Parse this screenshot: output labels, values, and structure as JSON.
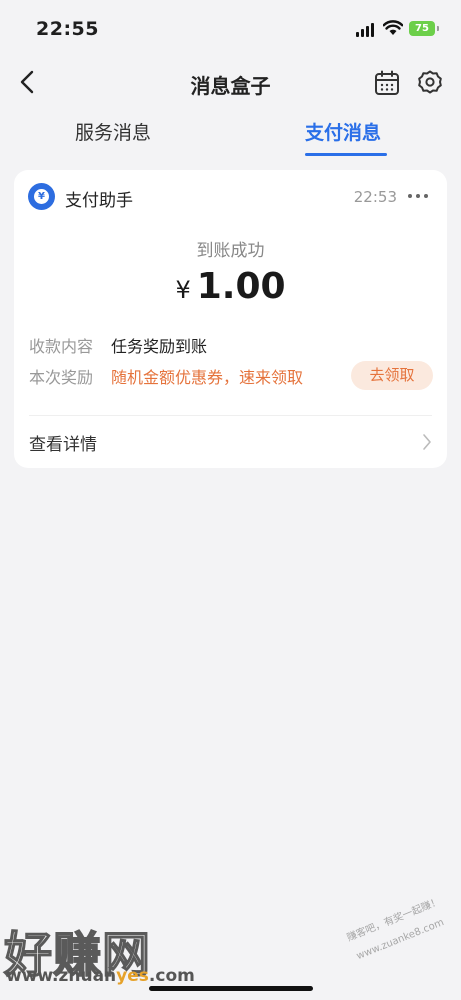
{
  "status_bar": {
    "time": "22:55",
    "battery": "75"
  },
  "nav": {
    "title": "消息盒子"
  },
  "tabs": [
    {
      "label": "服务消息",
      "active": false
    },
    {
      "label": "支付消息",
      "active": true
    }
  ],
  "card": {
    "sender": "支付助手",
    "time": "22:53",
    "status": "到账成功",
    "currency_symbol": "¥",
    "amount": "1.00",
    "rows": [
      {
        "label": "收款内容",
        "value": "任务奖励到账"
      },
      {
        "label": "本次奖励",
        "value": "随机金额优惠券，速来领取"
      }
    ],
    "claim_label": "去领取",
    "details_label": "查看详情"
  },
  "watermark": {
    "big": "好赚网",
    "url_prefix": "www.zhuan",
    "url_highlight": "yes",
    "url_suffix": ".com",
    "side_line1": "赚客吧，有奖一起赚！",
    "side_line2": "www.zuanke8.com"
  },
  "colors": {
    "accent": "#2a6fe8",
    "reward": "#e5733c",
    "battery": "#6ccf4a"
  }
}
